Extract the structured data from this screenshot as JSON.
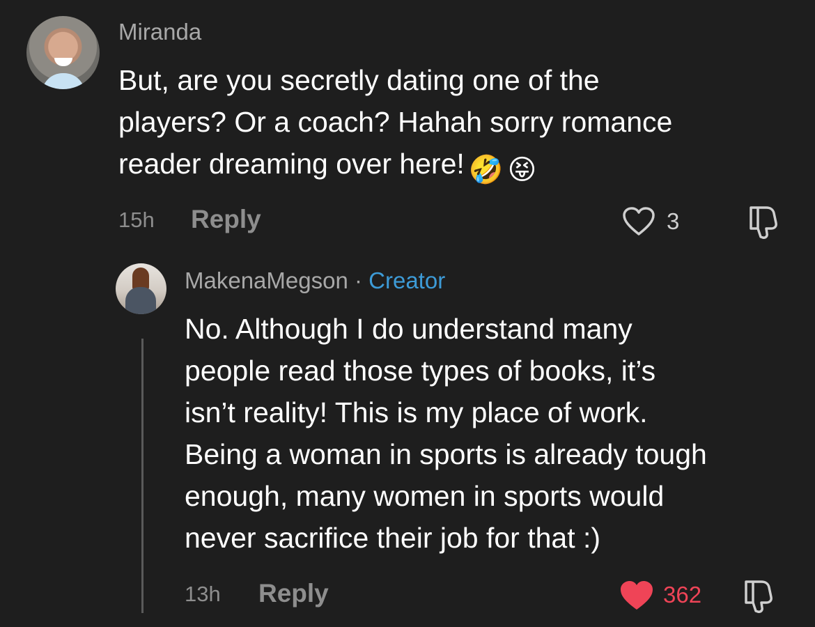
{
  "comment": {
    "username": "Miranda",
    "text": "But, are you secretly dating one of the\nplayers? Or a coach? Hahah sorry romance\nreader dreaming over here!",
    "emojis": [
      "🤣",
      "😝"
    ],
    "time": "15h",
    "reply_label": "Reply",
    "like_count": "3"
  },
  "reply": {
    "username": "MakenaMegson",
    "separator": "·",
    "creator_label": "Creator",
    "text": "No. Although I do understand many\npeople read those types of books, it’s\nisn’t reality! This is my place of work.\nBeing a woman in sports is already tough\nenough, many women in sports would\nnever sacrifice their job for that :)",
    "time": "13h",
    "reply_label": "Reply",
    "like_count": "362"
  },
  "colors": {
    "background": "#1e1e1e",
    "creator": "#3d9bd7",
    "liked": "#ef4457"
  },
  "icons": [
    "heart-outline-icon",
    "heart-filled-icon",
    "thumbs-down-icon"
  ]
}
